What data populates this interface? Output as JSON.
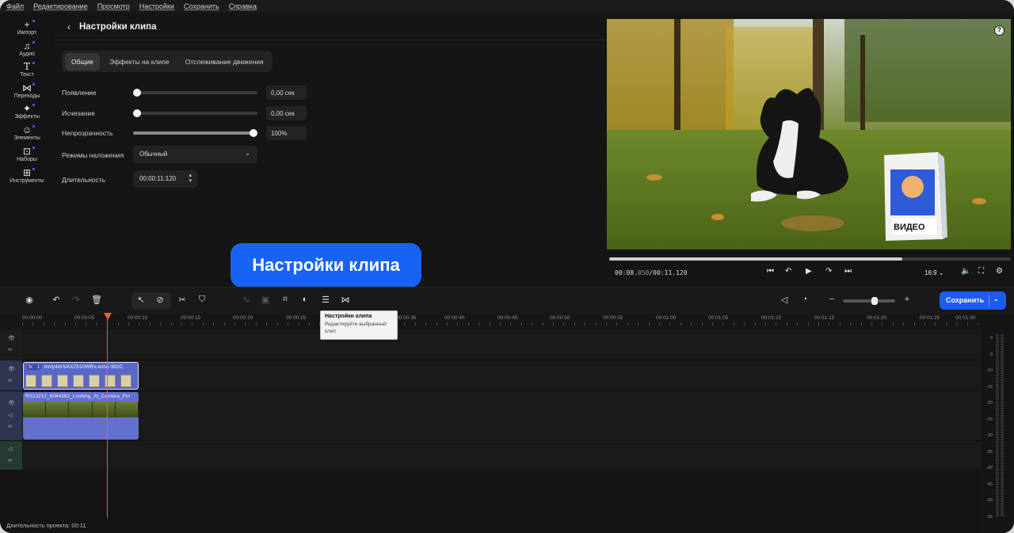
{
  "menubar": [
    "Файл",
    "Редактирование",
    "Просмотр",
    "Настройки",
    "Сохранить",
    "Справка"
  ],
  "rail": [
    {
      "label": "Импорт",
      "icon": "plus-icon"
    },
    {
      "label": "Аудио",
      "icon": "music-note-icon"
    },
    {
      "label": "Текст",
      "icon": "text-icon"
    },
    {
      "label": "Переходы",
      "icon": "transition-icon"
    },
    {
      "label": "Эффекты",
      "icon": "sparkle-icon"
    },
    {
      "label": "Элементы",
      "icon": "smiley-icon"
    },
    {
      "label": "Наборы",
      "icon": "pack-icon"
    },
    {
      "label": "Инструменты",
      "icon": "tools-grid-icon"
    }
  ],
  "panel": {
    "title": "Настройки клипа",
    "tabs": [
      "Общие",
      "Эффекты на клипе",
      "Отслеживание движения"
    ],
    "active_tab": "Общие",
    "fade_in": {
      "label": "Появление",
      "value": "0,00 сек",
      "level": 0
    },
    "fade_out": {
      "label": "Исчезание",
      "value": "0,00 сек",
      "level": 0
    },
    "opacity": {
      "label": "Непрозрачность",
      "value": "100%",
      "level": 1
    },
    "blend": {
      "label": "Режимы наложения",
      "value": "Обычный"
    },
    "duration": {
      "label": "Длительность",
      "value": "00:00:11:120"
    }
  },
  "preview": {
    "time_current": "00:08.",
    "time_current_ms": "050",
    "time_total": "/00:11.120",
    "progress": 0.73,
    "ratio": "16:9",
    "box_text": "ВИДЕО"
  },
  "callout": "Настройки клипа",
  "toolbar": {
    "save_label": "Сохранить",
    "tooltip_title": "Настройки клипа",
    "tooltip_desc": "Редактируйте выбранный клип"
  },
  "ruler": [
    "00:00:00",
    "00:00:05",
    "00:00:10",
    "00:00:15",
    "00:00:20",
    "00:00:25",
    "00:00:35",
    "00:00:40",
    "00:00:45",
    "00:00:50",
    "00:00:55",
    "00:01:00",
    "00:01:05",
    "00:01:10",
    "00:01:15",
    "00:01:20",
    "00:01:25",
    "00:01:30"
  ],
  "clips": {
    "overlay": {
      "fx": "fx · 1",
      "name": "mnly4dnVAXZh10WRv-emw-382C"
    },
    "main": {
      "name": "RS13212_6044363_Looking_At_Camera_Por"
    }
  },
  "meter": [
    "0",
    "-5",
    "-10",
    "-15",
    "-20",
    "-25",
    "-30",
    "-35",
    "-40",
    "-45",
    "-50",
    "-55"
  ],
  "status": "Длительность проекта: 00:11",
  "colors": {
    "accent": "#1e5bf0",
    "playhead": "#e5642c",
    "clip": "#5a67c9",
    "callout": "#1863f3"
  }
}
